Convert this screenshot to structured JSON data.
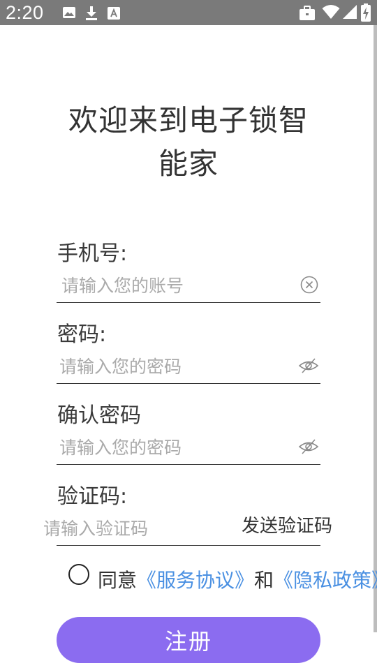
{
  "status_bar": {
    "time": "2:20",
    "icons": [
      "image-icon",
      "download-icon",
      "font-icon",
      "briefcase-icon",
      "wifi-icon",
      "signal-icon",
      "battery-charging-icon"
    ]
  },
  "title": {
    "line1": "欢迎来到电子锁智",
    "line2": "能家"
  },
  "form": {
    "phone_label": "手机号:",
    "phone_placeholder": "请输入您的账号",
    "password_label": "密码:",
    "password_placeholder": "请输入您的密码",
    "confirm_label": "确认密码",
    "confirm_placeholder": "请输入您的密码",
    "code_label": "验证码:",
    "code_placeholder": "请输入验证码",
    "send_code": "发送验证码"
  },
  "agreement": {
    "agree": "同意",
    "service": "《服务协议》",
    "and": "和",
    "privacy": "《隐私政策》"
  },
  "register_button": "注册",
  "colors": {
    "accent": "#8b6cf0",
    "link": "#4a90e2",
    "status_bar": "#7a7a7a"
  }
}
